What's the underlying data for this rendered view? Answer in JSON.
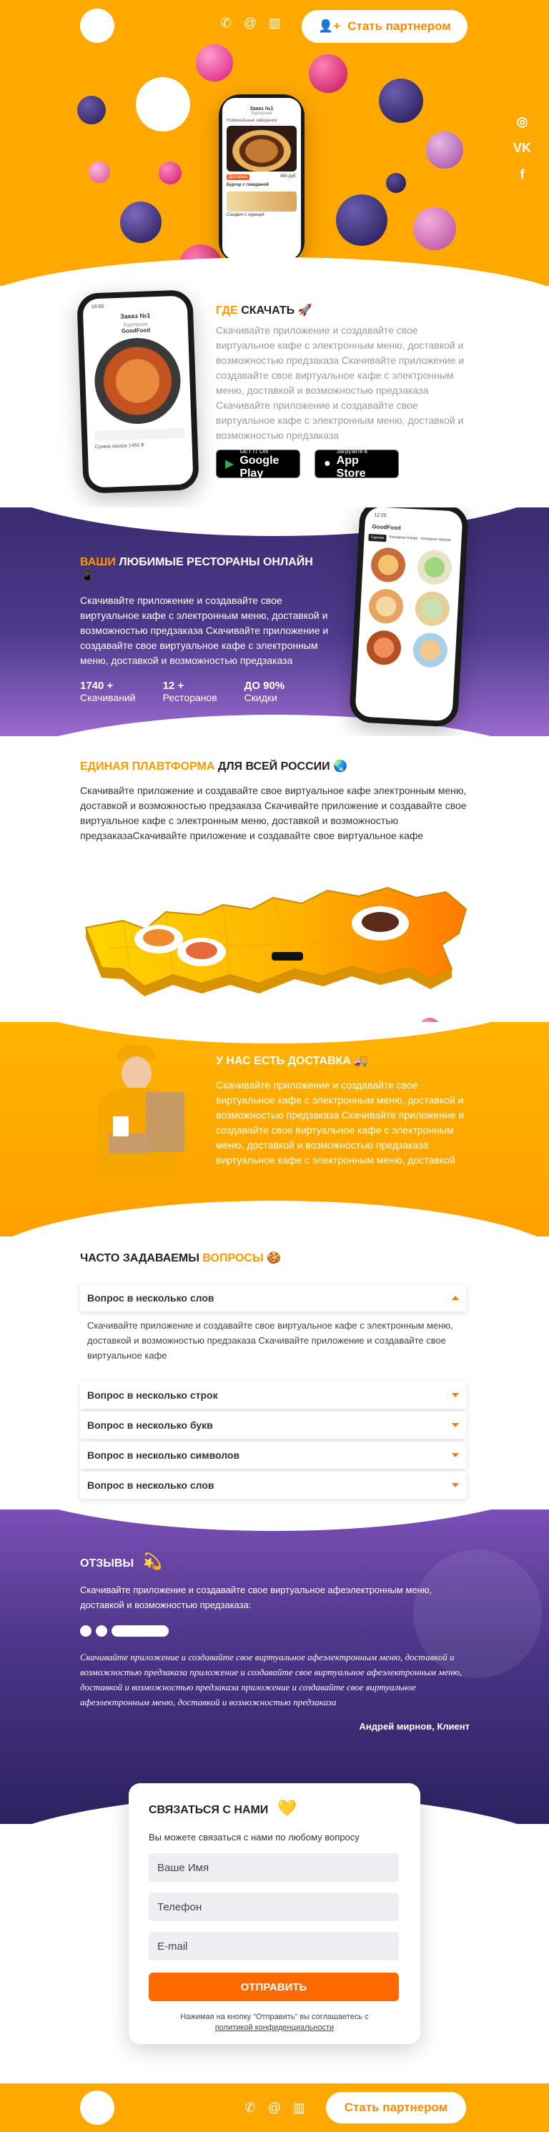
{
  "header": {
    "partner_button": "Стать партнером",
    "icons": [
      "phone-icon",
      "at-icon",
      "building-icon"
    ]
  },
  "social": {
    "instagram": "instagram-icon",
    "vk": "VK",
    "facebook": "f"
  },
  "hero_phone": {
    "title": "Заказ №1",
    "subtitle": "Бургерная",
    "section": "Номинальные заведения",
    "badge": "Доставка",
    "price": "490 руб.",
    "item": "Бургер с говядиной",
    "sub_item": "Сэндвич с курицей"
  },
  "download": {
    "title_accent": "ГДЕ",
    "title_rest": "СКАЧАТЬ",
    "title_emoji": "🚀",
    "text": "Скачивайте приложение и создавайте свое виртуальное кафе с электронным меню, доставкой и возможностью предзаказа Скачивайте приложение и создавайте свое виртуальное кафе с электронным меню, доставкой и возможностью предзаказа Скачивайте приложение и создавайте свое виртуальное кафе с электронным меню, доставкой и возможностью предзаказа",
    "google_small": "GET IT ON",
    "google_big": "Google Play",
    "apple_small": "Загрузите в",
    "apple_big": "App Store",
    "phone": {
      "time": "10:55",
      "title": "Заказ №1",
      "sub": "Бургерная",
      "name": "GoodFood",
      "total": "Сумма заказа 1450 ₽"
    }
  },
  "restaurants": {
    "title_accent": "ВАШИ",
    "title_rest": "ЛЮБИМЫЕ РЕСТОРАНЫ ОНЛАЙН",
    "title_emoji": "📱",
    "text": "Скачивайте приложение и создавайте свое виртуальное кафе  с электронным меню, доставкой и возможностью предзаказа Скачивайте приложение и создавайте свое виртуальное кафе с электронным меню, доставкой и возможностью предзаказа",
    "stats": [
      {
        "num": "1740 +",
        "label": "Скачиваний"
      },
      {
        "num": "12 +",
        "label": "Ресторанов"
      },
      {
        "num": "ДО 90%",
        "label": "Скидки"
      }
    ],
    "phone": {
      "time": "12:25",
      "title": "GoodFood",
      "tabs": [
        "Горячее",
        "Холодные блюда",
        "Холодные закуски"
      ]
    }
  },
  "platform": {
    "title_accent": "ЕДИНАЯ ПЛАВТФОРМА",
    "title_rest": "ДЛЯ ВСЕЙ РОССИИ",
    "title_emoji": "🌏",
    "text": "Скачивайте приложение и создавайте свое виртуальное кафе электронным меню, доставкой и возможностью предзаказа Скачивайте приложение и создавайте свое виртуальное кафе с электронным меню, доставкой и возможностью предзаказаСкачивайте приложение и создавайте свое виртуальное кафе"
  },
  "delivery": {
    "title": "У НАС ЕСТЬ ДОСТАВКА",
    "title_emoji": "🚚",
    "text": "Скачивайте приложение и создавайте свое виртуальное кафе с электронным меню, доставкой и возможностью предзаказа Скачивайте приложение и создавайте свое виртуальное кафе с электронным меню, доставкой и возможностью предзаказа виртуальное кафе с электронным меню, доставкой"
  },
  "faq": {
    "title_rest": "ЧАСТО ЗАДАВАЕМЫ",
    "title_accent": "ВОПРОСЫ",
    "title_emoji": "🍪",
    "items": [
      {
        "q": "Вопрос в несколько слов",
        "open": true
      },
      {
        "q": "Вопрос в несколько строк",
        "open": false
      },
      {
        "q": "Вопрос в несколько букв",
        "open": false
      },
      {
        "q": "Вопрос в несколько символов",
        "open": false
      },
      {
        "q": "Вопрос в несколько слов",
        "open": false
      }
    ],
    "answer": "Скачивайте приложение и создавайте свое виртуальное кафе  с электронным меню, доставкой и возможностью предзаказа Скачивайте приложение и создавайте свое виртуальное кафе"
  },
  "reviews": {
    "title": "ОТЗЫВЫ",
    "title_emoji": "💫",
    "intro": "Скачивайте приложение и создавайте свое виртуальное афеэлектронным меню, доставкой и возможностью предзаказа:",
    "quote": "Скачивайте приложение и создавайте свое виртуальное афеэлектронным меню, доставкой и возможностью предзаказа приложение и создавайте свое виртуальное афеэлектронным меню, доставкой и возможностью предзаказа приложение и создавайте свое виртуальное афеэлектронным меню, доставкой и возможностью предзаказа",
    "author": "Андрей мирнов, Клиент"
  },
  "contact": {
    "title": "СВЯЗАТЬСЯ С НАМИ",
    "title_emoji": "💛",
    "subtitle": "Вы можете связаться с нами  по любому вопросу",
    "name_placeholder": "Ваше Имя",
    "phone_placeholder": "Телефон",
    "email_placeholder": "E-mail",
    "submit": "ОТПРАВИТЬ",
    "consent": "Нажимая на кнопку “Отправить” вы соглашаетесь с",
    "policy_link": "политикой конфиденциальности"
  },
  "footer": {
    "partner_button": "Стать партнером"
  },
  "colors": {
    "accent": "#FFA800",
    "orange": "#FF6A00",
    "purple": "#3E2E7A",
    "text": "#222222"
  }
}
